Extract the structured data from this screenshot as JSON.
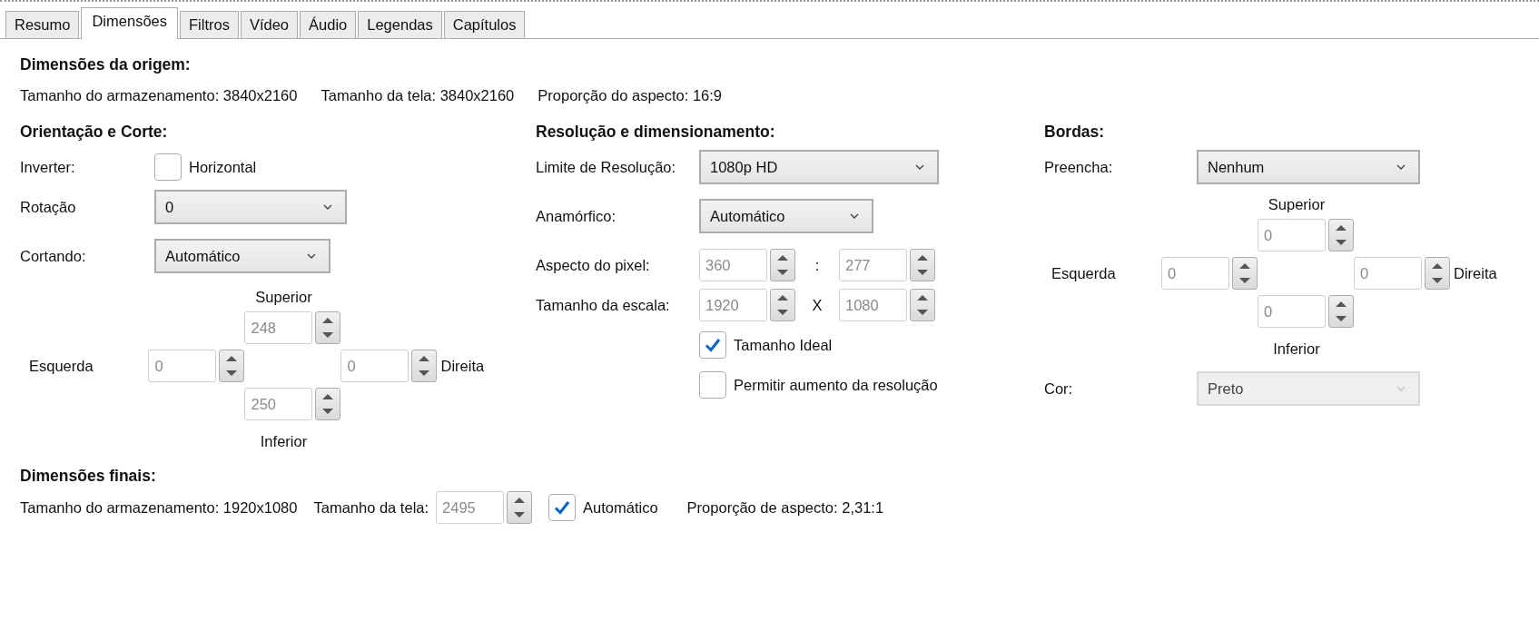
{
  "tabs": [
    {
      "label": "Resumo",
      "selected": false
    },
    {
      "label": "Dimensões",
      "selected": true
    },
    {
      "label": "Filtros",
      "selected": false
    },
    {
      "label": "Vídeo",
      "selected": false
    },
    {
      "label": "Áudio",
      "selected": false
    },
    {
      "label": "Legendas",
      "selected": false
    },
    {
      "label": "Capítulos",
      "selected": false
    }
  ],
  "source": {
    "title": "Dimensões da origem:",
    "items": [
      "Tamanho do armazenamento: 3840x2160",
      "Tamanho da tela: 3840x2160",
      "Proporção do aspecto: 16:9"
    ]
  },
  "columns": [
    {
      "title": "Orientação e Corte:",
      "rows": [
        {
          "kind": "checkbox",
          "label": "Inverter:",
          "option": "Horizontal",
          "checked": false
        },
        {
          "kind": "dropdown",
          "label": "Rotação",
          "value": "0",
          "disabled": false
        },
        {
          "kind": "dropdown",
          "label": "Cortando:",
          "value": "Automático",
          "disabled": false
        },
        {
          "kind": "cross",
          "top": {
            "label": "Superior",
            "value": "248",
            "disabled": true
          },
          "left": {
            "label": "Esquerda",
            "value": "0",
            "disabled": true
          },
          "right": {
            "label": "Direita",
            "value": "0",
            "disabled": true
          },
          "bottom": {
            "label": "Inferior",
            "value": "250",
            "disabled": true
          }
        }
      ]
    },
    {
      "title": "Resolução e dimensionamento:",
      "rows": [
        {
          "kind": "dropdown",
          "label": "Limite de Resolução:",
          "value": "1080p HD",
          "disabled": false
        },
        {
          "kind": "dropdown",
          "label": "Anamórfico:",
          "value": "Automático",
          "disabled": false
        },
        {
          "kind": "pair",
          "label": "Aspecto do pixel:",
          "first": {
            "value": "360",
            "disabled": true
          },
          "separator": ":",
          "second": {
            "value": "277",
            "disabled": true
          }
        },
        {
          "kind": "pair",
          "label": "Tamanho da escala:",
          "first": {
            "value": "1920",
            "disabled": true
          },
          "separator": "X",
          "second": {
            "value": "1080",
            "disabled": true
          }
        },
        {
          "kind": "checkbox",
          "option": "Tamanho Ideal",
          "checked": true
        },
        {
          "kind": "checkbox",
          "option": "Permitir aumento da resolução",
          "checked": false
        }
      ]
    },
    {
      "title": "Bordas:",
      "rows": [
        {
          "kind": "dropdown",
          "label": "Preencha:",
          "value": "Nenhum",
          "disabled": false
        },
        {
          "kind": "cross",
          "top": {
            "label": "Superior",
            "value": "0",
            "disabled": true
          },
          "left": {
            "label": "Esquerda",
            "value": "0",
            "disabled": true
          },
          "right": {
            "label": "Direita",
            "value": "0",
            "disabled": true
          },
          "bottom": {
            "label": "Inferior",
            "value": "0",
            "disabled": true
          }
        },
        {
          "kind": "dropdown",
          "label": "Cor:",
          "value": "Preto",
          "disabled": true
        }
      ]
    }
  ],
  "final": {
    "title": "Dimensões finais:",
    "items": [
      {
        "kind": "text",
        "text": "Tamanho do armazenamento: 1920x1080"
      },
      {
        "kind": "spinner",
        "label": "Tamanho da tela:",
        "value": "2495",
        "disabled": true
      },
      {
        "kind": "checkbox",
        "option": "Automático",
        "checked": true
      },
      {
        "kind": "text",
        "text": "Proporção de aspecto: 2,31:1"
      }
    ]
  }
}
